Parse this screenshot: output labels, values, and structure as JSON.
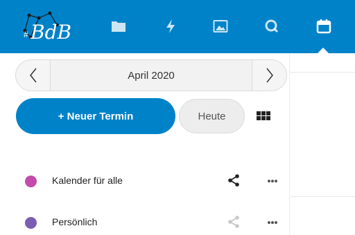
{
  "header": {
    "logo_text": "BdB",
    "bg_color": "#0082c9",
    "apps": [
      {
        "name": "files",
        "icon": "folder-icon"
      },
      {
        "name": "activity",
        "icon": "lightning-icon"
      },
      {
        "name": "photos",
        "icon": "image-icon"
      },
      {
        "name": "search",
        "icon": "search-icon"
      },
      {
        "name": "calendar",
        "icon": "calendar-icon",
        "active": true
      }
    ]
  },
  "sidebar": {
    "date_picker": {
      "label": "April 2020",
      "prev_icon": "chevron-left-icon",
      "next_icon": "chevron-right-icon"
    },
    "new_event_label": "+ Neuer Termin",
    "today_label": "Heute",
    "view_icon": "grid-view-icon",
    "calendars": [
      {
        "name": "Kalender für alle",
        "color": "#c44aab",
        "shared": true
      },
      {
        "name": "Persönlich",
        "color": "#7b5db3",
        "shared": false
      }
    ]
  }
}
